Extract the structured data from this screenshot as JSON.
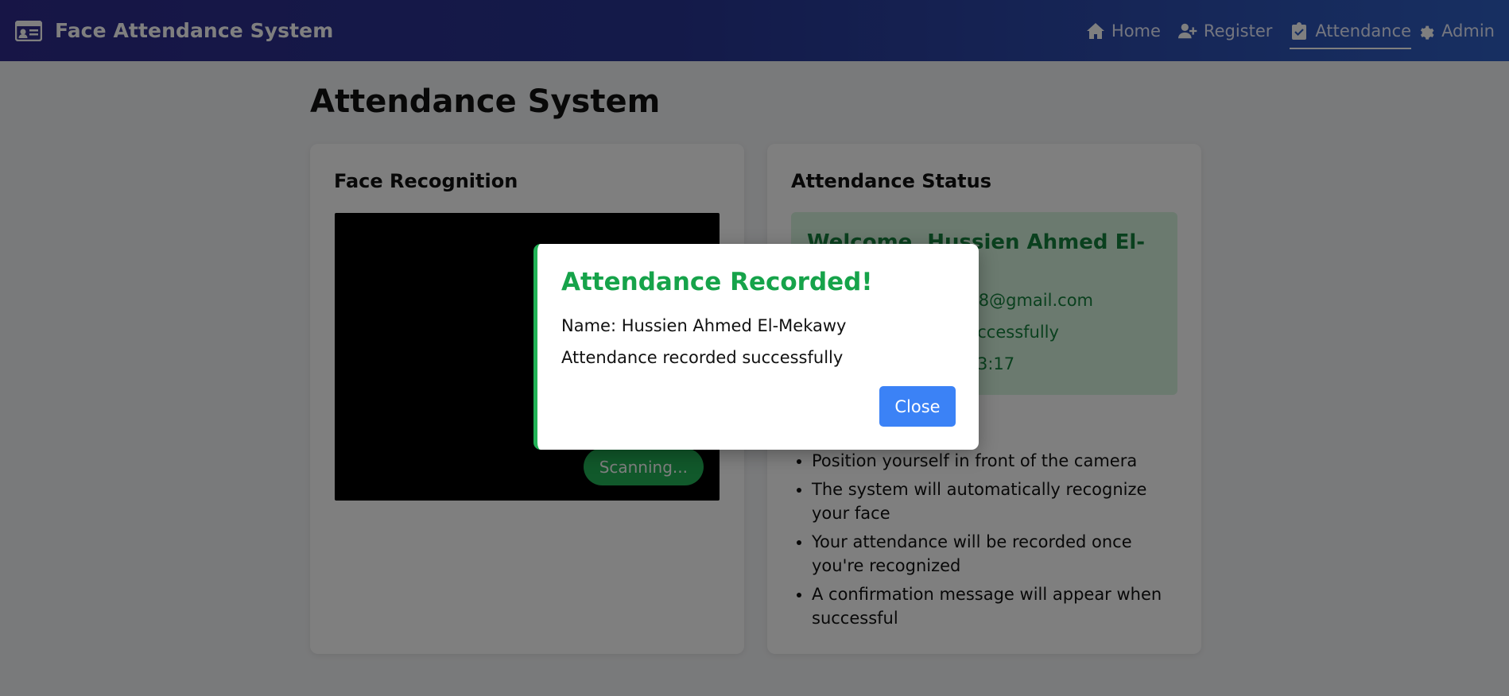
{
  "app": {
    "title": "Face Attendance System"
  },
  "nav": [
    {
      "label": "Home",
      "icon": "home-icon"
    },
    {
      "label": "Register",
      "icon": "user-plus-icon"
    },
    {
      "label": "Attendance",
      "icon": "clipboard-check-icon",
      "active": true
    },
    {
      "label": "Admin",
      "icon": "gear-icon"
    }
  ],
  "page": {
    "title": "Attendance System"
  },
  "face_card": {
    "title": "Face Recognition",
    "scan_status": "Scanning..."
  },
  "status_card": {
    "title": "Attendance Status",
    "welcome": "Welcome, Hussien Ahmed El-",
    "email_visible": "y38@gmail.com",
    "message_visible": "successfully",
    "time_visible": "3:17",
    "instructions": [
      "Position yourself in front of the camera",
      "The system will automatically recognize your face",
      "Your attendance will be recorded once you're recognized",
      "A confirmation message will appear when successful"
    ]
  },
  "modal": {
    "title": "Attendance Recorded!",
    "name_line": "Name: Hussien Ahmed El-Mekawy",
    "message_line": "Attendance recorded successfully",
    "close_label": "Close"
  },
  "colors": {
    "accent_green": "#16a34a",
    "button_blue": "#3b82f6",
    "nav_start": "#2e2b8c",
    "nav_end": "#2f5fc4"
  }
}
